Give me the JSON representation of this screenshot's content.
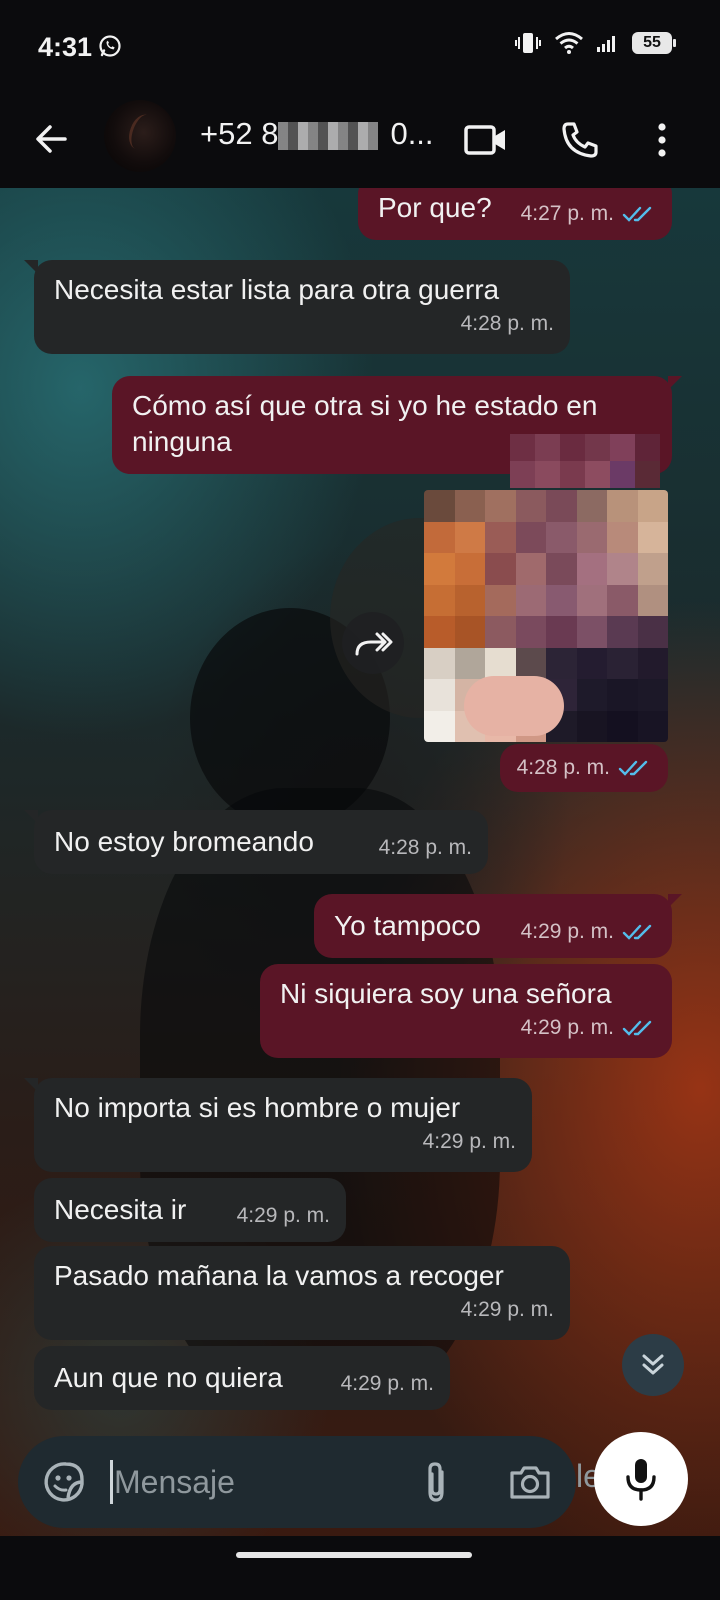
{
  "status_bar": {
    "time": "4:31",
    "battery": "55"
  },
  "header": {
    "contact_name": "+52 8",
    "contact_suffix": "0..."
  },
  "messages": [
    {
      "dir": "out",
      "text": "Por que?",
      "time": "4:27 p. m."
    },
    {
      "dir": "in",
      "text": "Necesita estar lista para otra guerra",
      "time": "4:28 p. m."
    },
    {
      "dir": "out",
      "text": "Cómo así que otra si yo he estado en ninguna",
      "time": ""
    },
    {
      "dir": "out",
      "type": "image",
      "time": "4:28 p. m."
    },
    {
      "dir": "in",
      "text": "No estoy bromeando",
      "time": "4:28 p. m."
    },
    {
      "dir": "out",
      "text": "Yo tampoco",
      "time": "4:29 p. m."
    },
    {
      "dir": "out",
      "text": "Ni siquiera soy una señora",
      "time": "4:29 p. m."
    },
    {
      "dir": "in",
      "text": "No importa si es hombre o mujer",
      "time": "4:29 p. m."
    },
    {
      "dir": "in",
      "text": "Necesita ir",
      "time": "4:29 p. m."
    },
    {
      "dir": "in",
      "text": "Pasado mañana la vamos a recoger",
      "time": "4:29 p. m."
    },
    {
      "dir": "in",
      "text": "Aun que no quiera",
      "time": "4:29 p. m."
    }
  ],
  "input": {
    "placeholder": "Mensaje",
    "ghost_text": "le"
  },
  "colors": {
    "incoming_bubble": "#242627",
    "outgoing_bubble": "#5a1526",
    "read_ticks": "#53bdeb",
    "input_bg": "#1f2a30"
  }
}
